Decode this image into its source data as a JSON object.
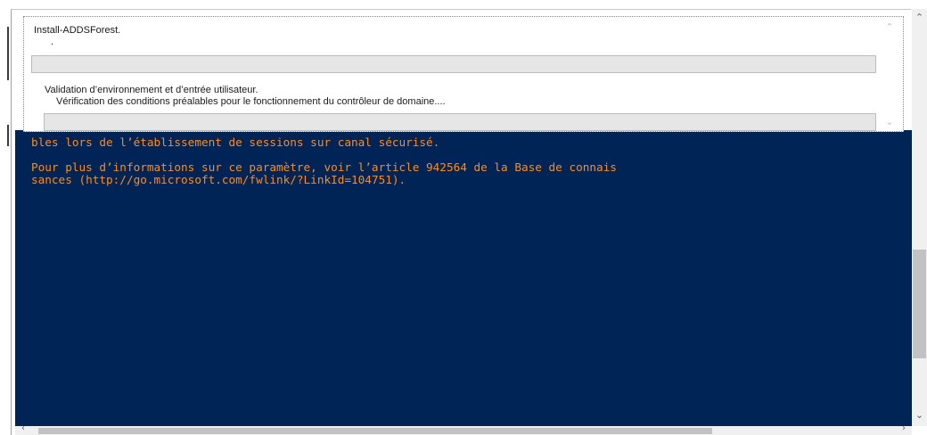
{
  "console": {
    "line1": "bles lors de l’établissement de sessions sur canal sécurisé.",
    "line2": "Pour plus d’informations sur ce paramètre, voir l’article 942564 de la Base de connais",
    "line3": "sances (http://go.microsoft.com/fwlink/?LinkId=104751).",
    "text_color": "#ff8c1a",
    "background_color": "#012456"
  },
  "progress": {
    "title": "Install-ADDSForest.",
    "dot": ".",
    "activity": "Validation d’environnement et d’entrée utilisateur.",
    "status": "Vérification des conditions préalables pour le fonctionnement du contrôleur de domaine...."
  },
  "icons": {
    "scroll_up": "chevron-up-icon",
    "scroll_down": "chevron-down-icon",
    "scroll_left": "chevron-left-icon",
    "scroll_right": "chevron-right-icon"
  }
}
